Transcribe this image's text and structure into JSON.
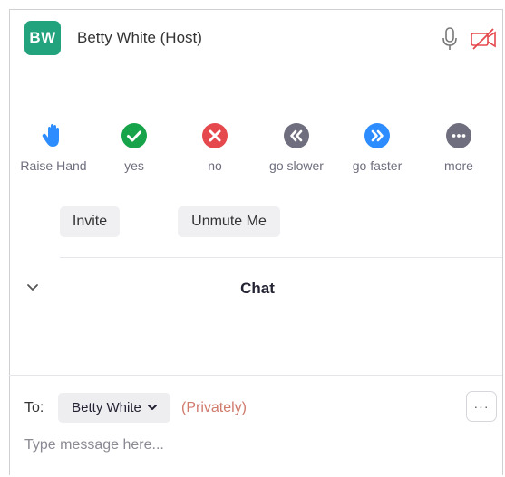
{
  "participant": {
    "initials": "BW",
    "name": "Betty White (Host)",
    "avatar_color": "#23a27e"
  },
  "reactions": [
    {
      "label": "Raise Hand",
      "icon": "raise-hand-icon",
      "color": "#2d8cff"
    },
    {
      "label": "yes",
      "icon": "check-icon",
      "color": "#16a34a"
    },
    {
      "label": "no",
      "icon": "x-icon",
      "color": "#e5484d"
    },
    {
      "label": "go slower",
      "icon": "rewind-icon",
      "color": "#6e6e7e"
    },
    {
      "label": "go faster",
      "icon": "fast-forward-icon",
      "color": "#2d8cff"
    },
    {
      "label": "more",
      "icon": "more-icon",
      "color": "#6e6e7e"
    }
  ],
  "actions": {
    "invite": "Invite",
    "unmute": "Unmute Me"
  },
  "chat": {
    "title": "Chat",
    "to_label": "To:",
    "recipient": "Betty White",
    "privately": "(Privately)",
    "more_label": "···",
    "placeholder": "Type message here..."
  }
}
